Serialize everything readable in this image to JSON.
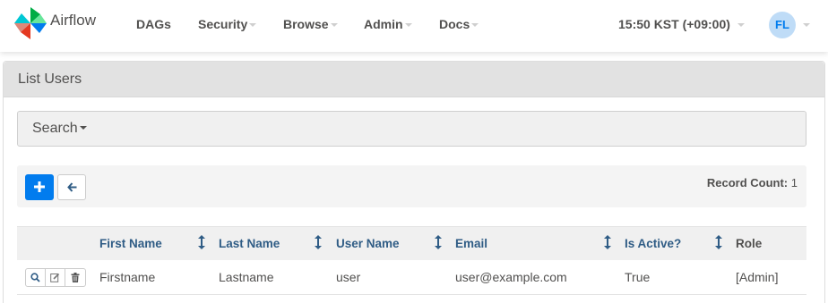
{
  "brand": {
    "name": "Airflow",
    "logo_icon": "airflow-pinwheel-icon"
  },
  "nav": {
    "items": [
      {
        "label": "DAGs",
        "has_dropdown": false
      },
      {
        "label": "Security",
        "has_dropdown": true
      },
      {
        "label": "Browse",
        "has_dropdown": true
      },
      {
        "label": "Admin",
        "has_dropdown": true
      },
      {
        "label": "Docs",
        "has_dropdown": true
      }
    ],
    "timezone": "15:50 KST (+09:00)",
    "user_initials": "FL"
  },
  "panel": {
    "title": "List Users"
  },
  "search": {
    "label": "Search"
  },
  "actions": {
    "add_icon": "plus-icon",
    "back_icon": "arrow-left-icon",
    "record_count_label": "Record Count:",
    "record_count_value": "1"
  },
  "table": {
    "columns": [
      "First Name",
      "Last Name",
      "User Name",
      "Email",
      "Is Active?",
      "Role"
    ],
    "rows": [
      {
        "first_name": "Firstname",
        "last_name": "Lastname",
        "user_name": "user",
        "email": "user@example.com",
        "is_active": "True",
        "role": "[Admin]"
      }
    ],
    "row_action_icons": [
      "search-icon",
      "edit-icon",
      "trash-icon"
    ]
  },
  "colors": {
    "primary": "#017cee",
    "header_text": "#2f5c85",
    "text": "#51504f",
    "avatar_bg": "#bfdcf7"
  }
}
